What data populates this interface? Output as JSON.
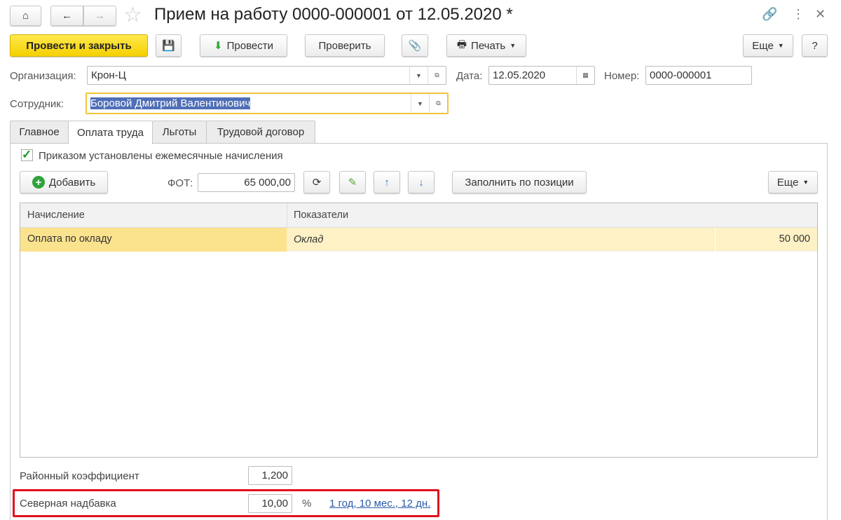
{
  "header": {
    "title": "Прием на работу 0000-000001 от 12.05.2020 *"
  },
  "toolbar": {
    "post_close": "Провести и закрыть",
    "post": "Провести",
    "check": "Проверить",
    "print": "Печать",
    "more": "Еще",
    "help": "?"
  },
  "form": {
    "org_label": "Организация:",
    "org_value": "Крон-Ц",
    "date_label": "Дата:",
    "date_value": "12.05.2020",
    "number_label": "Номер:",
    "number_value": "0000-000001",
    "employee_label": "Сотрудник:",
    "employee_value": "Боровой Дмитрий Валентинович"
  },
  "tabs": [
    {
      "label": "Главное"
    },
    {
      "label": "Оплата труда"
    },
    {
      "label": "Льготы"
    },
    {
      "label": "Трудовой договор"
    }
  ],
  "pay": {
    "checkbox_label": "Приказом установлены ежемесячные начисления",
    "checked": true,
    "add": "Добавить",
    "fot_label": "ФОТ:",
    "fot_value": "65 000,00",
    "fill": "Заполнить по позиции",
    "more": "Еще"
  },
  "table": {
    "headers": [
      "Начисление",
      "Показатели"
    ],
    "rows": [
      {
        "accrual": "Оплата по окладу",
        "indicator": "Оклад",
        "value": "50 000"
      }
    ]
  },
  "bottom": {
    "district_label": "Районный коэффициент",
    "district_value": "1,200",
    "north_label": "Северная надбавка",
    "north_value": "10,00",
    "percent": "%",
    "north_link": "1 год, 10 мес., 12 дн."
  }
}
